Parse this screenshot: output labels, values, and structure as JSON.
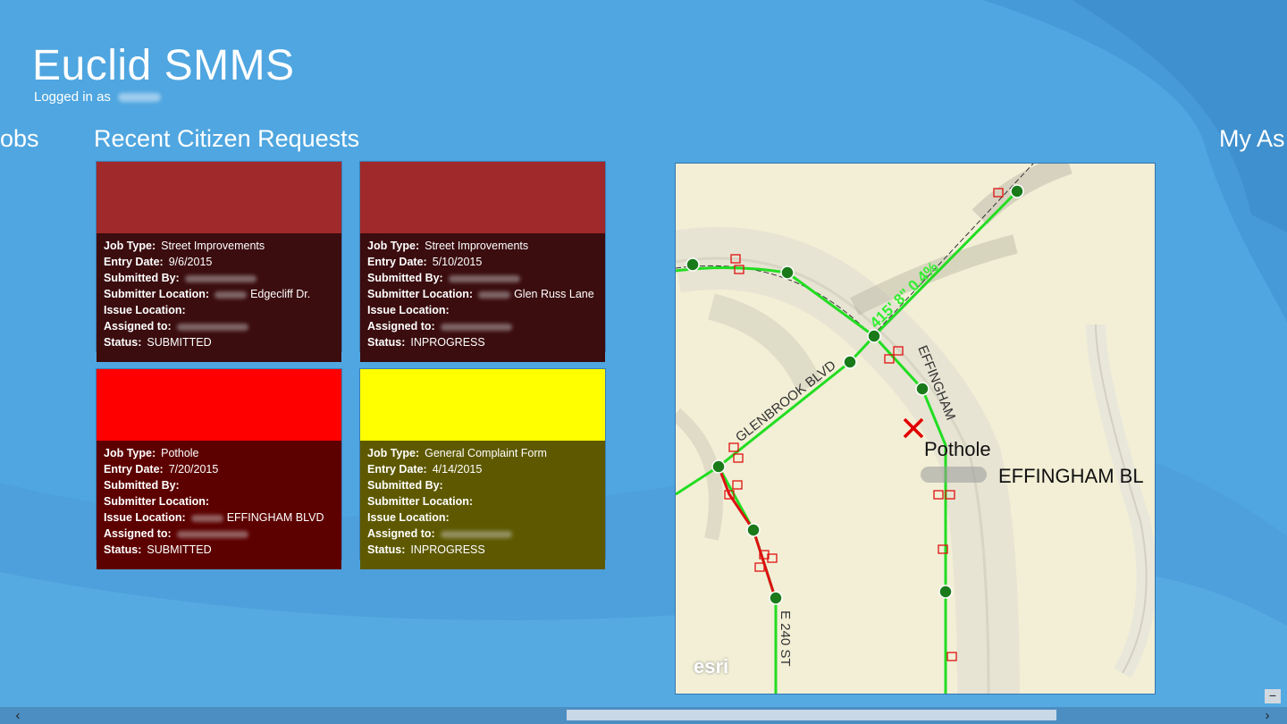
{
  "app": {
    "title": "Euclid SMMS",
    "logged_in_prefix": "Logged in as"
  },
  "sections": {
    "left_partial": "obs",
    "main": "Recent Citizen Requests",
    "right_partial": "My As"
  },
  "labels": {
    "job_type": "Job Type:",
    "entry_date": "Entry Date:",
    "submitted_by": "Submitted By:",
    "submitter_location": "Submitter Location:",
    "issue_location": "Issue Location:",
    "assigned_to": "Assigned to:",
    "status": "Status:"
  },
  "colors": {
    "tile1_swatch": "#a0292b",
    "tile1_info": "#3b0d0f",
    "tile2_swatch": "#a0292b",
    "tile2_info": "#3b0d0f",
    "tile3_swatch": "#ff0000",
    "tile3_info": "#5d0000",
    "tile4_swatch": "#ffff00",
    "tile4_info": "#5e5900"
  },
  "requests": [
    {
      "job_type": "Street Improvements",
      "entry_date": "9/6/2015",
      "submitter_location": "Edgecliff Dr.",
      "issue_location": "",
      "status": "SUBMITTED"
    },
    {
      "job_type": "Street Improvements",
      "entry_date": "5/10/2015",
      "submitter_location": "Glen Russ Lane",
      "issue_location": "",
      "status": "INPROGRESS"
    },
    {
      "job_type": "Pothole",
      "entry_date": "7/20/2015",
      "submitter_location": "",
      "issue_location": "EFFINGHAM BLVD",
      "status": "SUBMITTED"
    },
    {
      "job_type": "General Complaint Form",
      "entry_date": "4/14/2015",
      "submitter_location": "",
      "issue_location": "",
      "status": "INPROGRESS"
    }
  ],
  "map": {
    "street_glenbrook": "GLENBROOK BLVD",
    "street_effingham": "EFFINGHAM",
    "street_240": "E 240 ST",
    "pipe_label": "415' 8\" 0.4%",
    "marker_title": "Pothole",
    "marker_address": "EFFINGHAM BL",
    "attribution": "esri"
  },
  "scrollbar": {
    "left_arrow": "‹",
    "right_arrow": "›",
    "collapse": "−"
  }
}
